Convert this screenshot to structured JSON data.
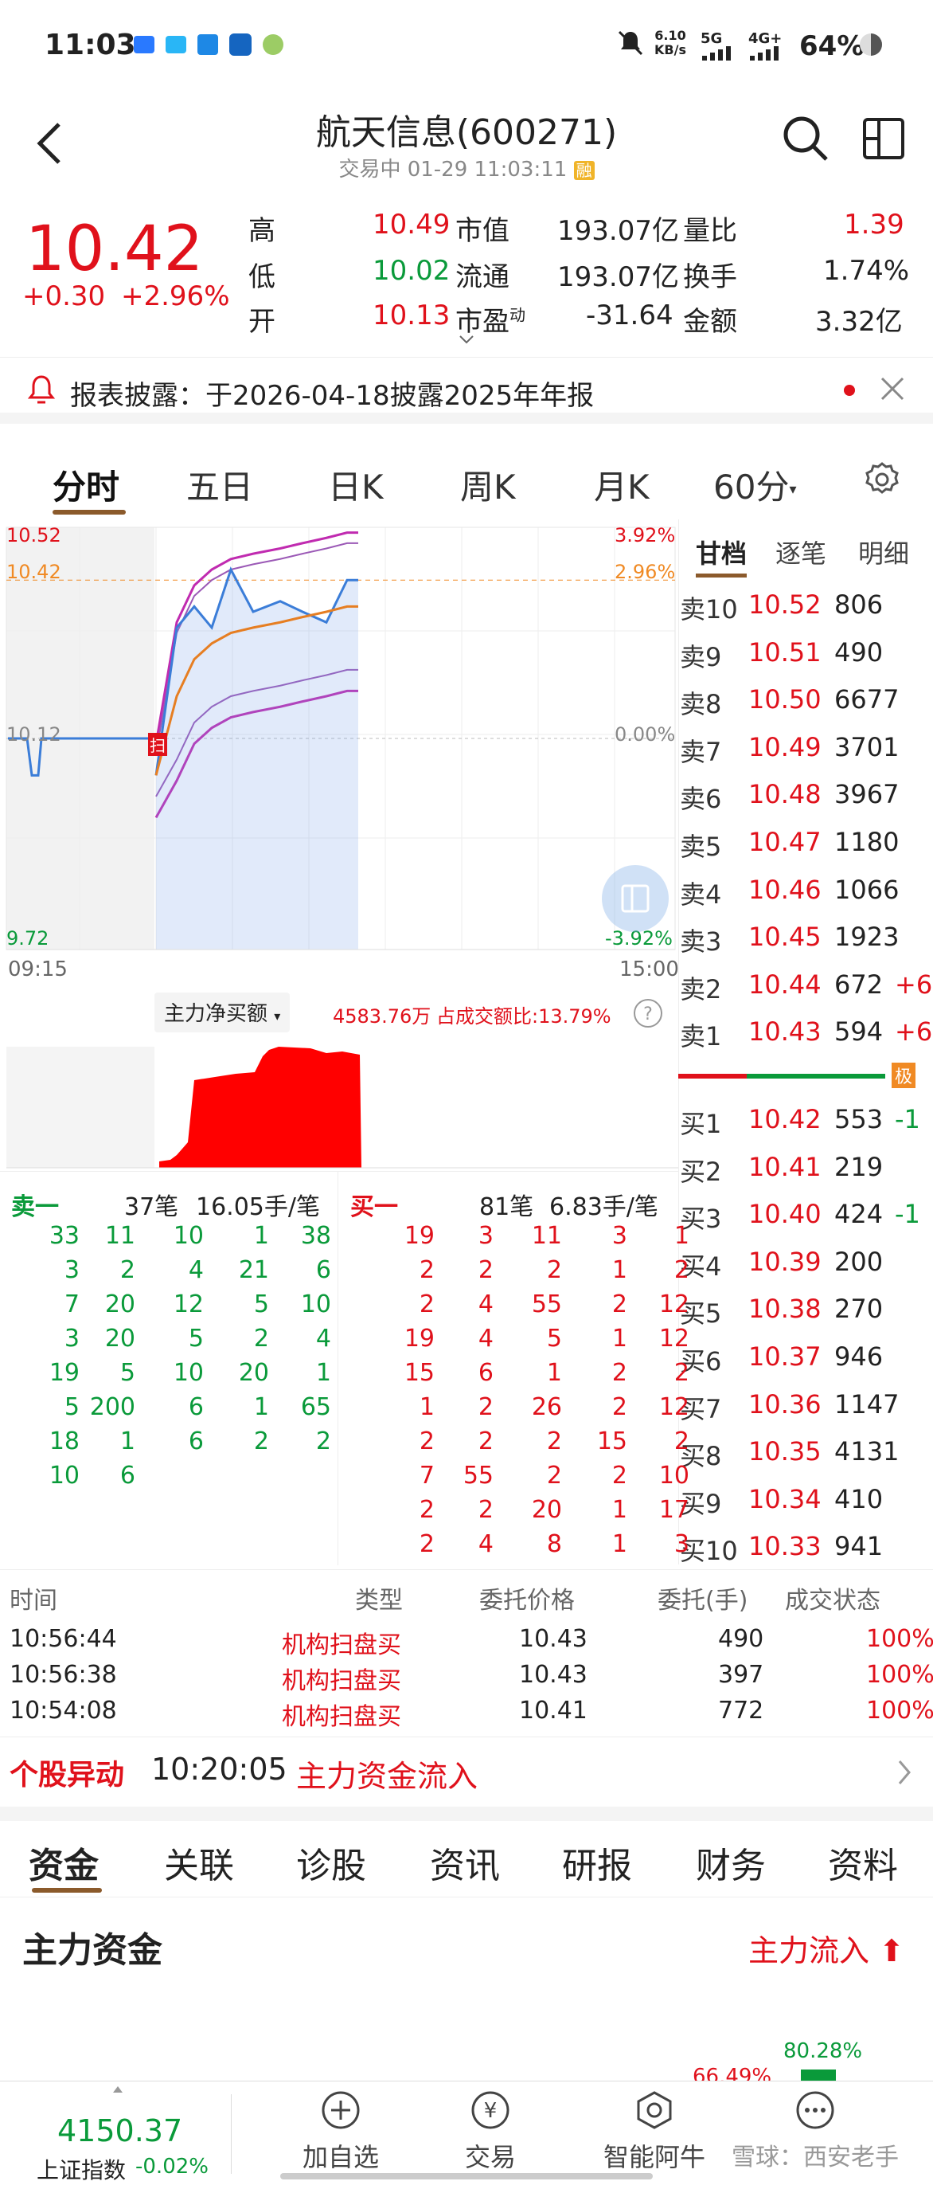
{
  "status_bar": {
    "time": "11:03",
    "speed_value": "6.10",
    "speed_unit": "KB/s",
    "network1": "5G",
    "network2": "4G+",
    "battery": "64%"
  },
  "header": {
    "title": "航天信息(600271)",
    "subtitle": "交易中 01-29 11:03:11",
    "margin_badge": "融"
  },
  "quote": {
    "price": "10.42",
    "change": "+0.30",
    "change_pct": "+2.96%",
    "fields": [
      {
        "label": "高",
        "value": "10.49",
        "color": "red"
      },
      {
        "label": "低",
        "value": "10.02",
        "color": "green"
      },
      {
        "label": "开",
        "value": "10.13",
        "color": "red"
      }
    ],
    "fields2": [
      {
        "label": "市值",
        "value": "193.07亿"
      },
      {
        "label": "流通",
        "value": "193.07亿"
      },
      {
        "label": "市盈",
        "sup": "动",
        "value": "-31.64"
      }
    ],
    "fields3": [
      {
        "label": "量比",
        "value": "1.39",
        "color": "red"
      },
      {
        "label": "换手",
        "value": "1.74%",
        "color": "black"
      },
      {
        "label": "金额",
        "value": "3.32亿",
        "color": "black"
      }
    ]
  },
  "notice": {
    "text": "报表披露：于2026-04-18披露2025年年报"
  },
  "chart_tabs": [
    "分时",
    "五日",
    "日K",
    "周K",
    "月K",
    "60分"
  ],
  "intraday": {
    "y_labels_left": [
      "10.52",
      "10.42",
      "10.12",
      "9.72"
    ],
    "y_labels_right": [
      "3.92%",
      "2.96%",
      "0.00%",
      "-3.92%"
    ],
    "x_start": "09:15",
    "x_end": "15:00",
    "scan_marker": "扫"
  },
  "chart_data": {
    "type": "line",
    "title": "",
    "xlabel": "",
    "ylabel": "",
    "x": [
      "09:15",
      "09:30",
      "09:40",
      "09:50",
      "10:00",
      "10:10",
      "10:20",
      "10:30",
      "10:40",
      "10:50",
      "11:00",
      "11:03"
    ],
    "series": [
      {
        "name": "",
        "values": [
          10.12,
          10.05,
          10.33,
          10.37,
          10.33,
          10.44,
          10.36,
          10.38,
          10.36,
          10.34,
          10.42,
          10.42
        ]
      },
      {
        "name": "",
        "values": [
          null,
          10.05,
          10.2,
          10.27,
          10.3,
          10.32,
          10.33,
          10.34,
          10.35,
          10.36,
          10.37,
          10.37
        ]
      }
    ],
    "ylim": [
      9.72,
      10.52
    ],
    "reference_line": 10.42,
    "prev_close": 10.12
  },
  "main_flow": {
    "dropdown": "主力净买额",
    "amount": "4583.76万",
    "ratio_label": "占成交额比:",
    "ratio": "13.79%"
  },
  "order_book": {
    "tabs": [
      "甘档",
      "逐笔",
      "明细"
    ],
    "asks": [
      {
        "label": "卖10",
        "price": "10.52",
        "vol": "806",
        "chg": ""
      },
      {
        "label": "卖9",
        "price": "10.51",
        "vol": "490",
        "chg": ""
      },
      {
        "label": "卖8",
        "price": "10.50",
        "vol": "6677",
        "chg": ""
      },
      {
        "label": "卖7",
        "price": "10.49",
        "vol": "3701",
        "chg": ""
      },
      {
        "label": "卖6",
        "price": "10.48",
        "vol": "3967",
        "chg": ""
      },
      {
        "label": "卖5",
        "price": "10.47",
        "vol": "1180",
        "chg": ""
      },
      {
        "label": "卖4",
        "price": "10.46",
        "vol": "1066",
        "chg": ""
      },
      {
        "label": "卖3",
        "price": "10.45",
        "vol": "1923",
        "chg": ""
      },
      {
        "label": "卖2",
        "price": "10.44",
        "vol": "672",
        "chg": "+6"
      },
      {
        "label": "卖1",
        "price": "10.43",
        "vol": "594",
        "chg": "+6"
      }
    ],
    "level_badge": "极",
    "bids": [
      {
        "label": "买1",
        "price": "10.42",
        "vol": "553",
        "chg": "-1"
      },
      {
        "label": "买2",
        "price": "10.41",
        "vol": "219",
        "chg": ""
      },
      {
        "label": "买3",
        "price": "10.40",
        "vol": "424",
        "chg": "-1"
      },
      {
        "label": "买4",
        "price": "10.39",
        "vol": "200",
        "chg": ""
      },
      {
        "label": "买5",
        "price": "10.38",
        "vol": "270",
        "chg": ""
      },
      {
        "label": "买6",
        "price": "10.37",
        "vol": "946",
        "chg": ""
      },
      {
        "label": "买7",
        "price": "10.36",
        "vol": "1147",
        "chg": ""
      },
      {
        "label": "买8",
        "price": "10.35",
        "vol": "4131",
        "chg": ""
      },
      {
        "label": "买9",
        "price": "10.34",
        "vol": "410",
        "chg": ""
      },
      {
        "label": "买10",
        "price": "10.33",
        "vol": "941",
        "chg": ""
      }
    ]
  },
  "queue": {
    "sell_head": {
      "label": "卖一",
      "count": "37笔",
      "avg": "16.05手/笔"
    },
    "buy_head": {
      "label": "买一",
      "count": "81笔",
      "avg": "6.83手/笔"
    },
    "sell": [
      [
        "33",
        "11",
        "10",
        "1",
        "38"
      ],
      [
        "3",
        "2",
        "4",
        "21",
        "6"
      ],
      [
        "7",
        "20",
        "12",
        "5",
        "10"
      ],
      [
        "3",
        "20",
        "5",
        "2",
        "4"
      ],
      [
        "19",
        "5",
        "10",
        "20",
        "1"
      ],
      [
        "5",
        "200",
        "6",
        "1",
        "65"
      ],
      [
        "18",
        "1",
        "6",
        "2",
        "2"
      ],
      [
        "10",
        "6",
        "",
        "",
        ""
      ]
    ],
    "buy": [
      [
        "19",
        "3",
        "11",
        "3",
        "1"
      ],
      [
        "2",
        "2",
        "2",
        "1",
        "2"
      ],
      [
        "2",
        "4",
        "55",
        "2",
        "12"
      ],
      [
        "19",
        "4",
        "5",
        "1",
        "12"
      ],
      [
        "15",
        "6",
        "1",
        "2",
        "2"
      ],
      [
        "1",
        "2",
        "26",
        "2",
        "12"
      ],
      [
        "2",
        "2",
        "2",
        "15",
        "2"
      ],
      [
        "7",
        "55",
        "2",
        "2",
        "10"
      ],
      [
        "2",
        "2",
        "20",
        "1",
        "17"
      ],
      [
        "2",
        "4",
        "8",
        "1",
        "3"
      ]
    ]
  },
  "orders": {
    "headers": [
      "时间",
      "类型",
      "委托价格",
      "委托(手)",
      "成交状态"
    ],
    "rows": [
      {
        "time": "10:56:44",
        "type": "机构扫盘买",
        "price": "10.43",
        "qty": "490",
        "status": "100%"
      },
      {
        "time": "10:56:38",
        "type": "机构扫盘买",
        "price": "10.43",
        "qty": "397",
        "status": "100%"
      },
      {
        "time": "10:54:08",
        "type": "机构扫盘买",
        "price": "10.41",
        "qty": "772",
        "status": "100%"
      }
    ]
  },
  "alert": {
    "label": "个股异动",
    "time": "10:20:05",
    "text": "主力资金流入"
  },
  "section_tabs": [
    "资金",
    "关联",
    "诊股",
    "资讯",
    "研报",
    "财务",
    "资料"
  ],
  "capital": {
    "title": "主力资金",
    "flow": "主力流入",
    "pct1": "80.28%",
    "pct2": "66.49%"
  },
  "bottom_nav": {
    "index_value": "4150.37",
    "index_name": "上证指数",
    "index_change": "-0.02%",
    "items": [
      "加自选",
      "交易",
      "智能阿牛",
      "雪球：西安老手"
    ]
  },
  "colors": {
    "red": "#e0111b",
    "green": "#0a9a3a",
    "accent": "#8b5a2b",
    "orange": "#f08a24",
    "avg_line": "#e67e22",
    "price_line": "#3b7dd8",
    "band": "#c02bb0"
  }
}
